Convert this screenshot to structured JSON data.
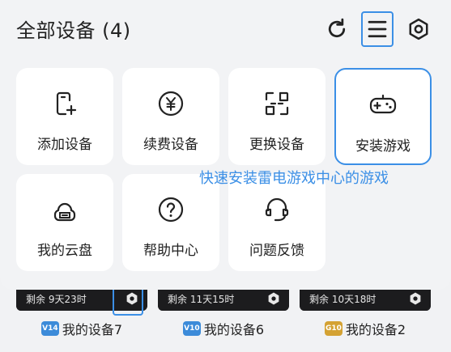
{
  "header": {
    "title": "全部设备 (4)"
  },
  "tiles": [
    {
      "label": "添加设备"
    },
    {
      "label": "续费设备"
    },
    {
      "label": "更换设备"
    },
    {
      "label": "安装游戏"
    },
    {
      "label": "我的云盘"
    },
    {
      "label": "帮助中心"
    },
    {
      "label": "问题反馈"
    }
  ],
  "tooltip": {
    "text": "快速安装雷电游戏中心的游戏"
  },
  "devices": [
    {
      "time": "剩余 9天23时",
      "badge": "V14",
      "name": "我的设备7"
    },
    {
      "time": "剩余 11天15时",
      "badge": "V10",
      "name": "我的设备6"
    },
    {
      "time": "剩余 10天18时",
      "badge": "G10",
      "name": "我的设备2"
    }
  ],
  "colors": {
    "accent": "#3b8fe6",
    "panel": "#f2f3f5",
    "tile": "#ffffff"
  }
}
